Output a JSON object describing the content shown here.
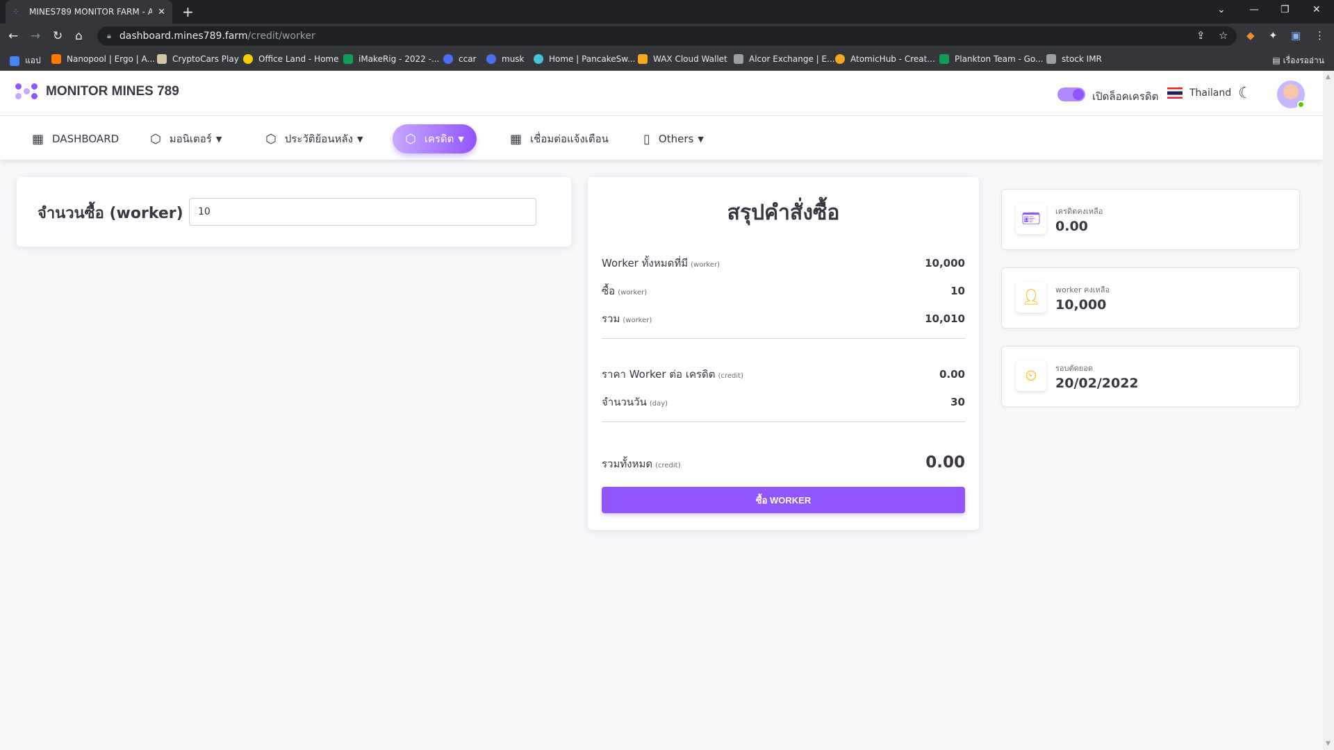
{
  "browser": {
    "tab_title": "MINES789 MONITOR FARM - As",
    "url_host": "dashboard.mines789.farm",
    "url_path": "/credit/worker",
    "bookmarks": [
      {
        "label": "แอป",
        "color": "#4285f4"
      },
      {
        "label": "Nanopool | Ergo | A...",
        "color": "#ff7a00"
      },
      {
        "label": "CryptoCars Play",
        "color": "#d1c7a3"
      },
      {
        "label": "Office Land - Home",
        "color": "#f4d000"
      },
      {
        "label": "iMakeRig - 2022 -...",
        "color": "#0f9d58"
      },
      {
        "label": "ccar",
        "color": "#4c6ef5"
      },
      {
        "label": "musk",
        "color": "#4c6ef5"
      },
      {
        "label": "Home | PancakeSw...",
        "color": "#43c4d6"
      },
      {
        "label": "WAX Cloud Wallet",
        "color": "#f5a623"
      },
      {
        "label": "Alcor Exchange | E...",
        "color": "#9aa0a6"
      },
      {
        "label": "AtomicHub - Creat...",
        "color": "#f5a623"
      },
      {
        "label": "Plankton Team - Go...",
        "color": "#0f9d58"
      },
      {
        "label": "stock IMR",
        "color": "#9aa0a6"
      }
    ],
    "reading_list": "เรื่องรออ่าน"
  },
  "header": {
    "brand": "MONITOR MINES 789",
    "toggle_label": "เปิดล็อคเครดิต",
    "toggle_on": true,
    "country": "Thailand",
    "accent": "#9155fd"
  },
  "nav": {
    "dashboard": "DASHBOARD",
    "monitor": "มอนิเตอร์",
    "history": "ประวัติย้อนหลัง",
    "credit": "เครดิต",
    "notify": "เชื่อมต่อแจ้งเตือน",
    "others": "Others"
  },
  "purchase": {
    "label": "จำนวนซื้อ (worker)",
    "value": "10"
  },
  "summary": {
    "title": "สรุปคำสั่งซื้อ",
    "rows": [
      {
        "label": "Worker ทั้งหมดที่มี",
        "unit": "(worker)",
        "value": "10,000"
      },
      {
        "label": "ซื้อ",
        "unit": "(worker)",
        "value": "10"
      },
      {
        "label": "รวม",
        "unit": "(worker)",
        "value": "10,010"
      },
      {
        "label": "ราคา Worker ต่อ เครดิต",
        "unit": "(credit)",
        "value": "0.00"
      },
      {
        "label": "จำนวนวัน",
        "unit": "(day)",
        "value": "30"
      },
      {
        "label": "รวมทั้งหมด",
        "unit": "(credit)",
        "value": "0.00"
      }
    ],
    "button": "ซื้อ WORKER"
  },
  "stats": [
    {
      "label": "เครดิตคงเหลือ",
      "value": "0.00",
      "icon": "id-card-icon",
      "color": "#9155fd"
    },
    {
      "label": "worker คงเหลือ",
      "value": "10,000",
      "icon": "user-icon",
      "color": "#ffb400"
    },
    {
      "label": "รอบตัดยอด",
      "value": "20/02/2022",
      "icon": "user-clock-icon",
      "color": "#ffb400"
    }
  ]
}
